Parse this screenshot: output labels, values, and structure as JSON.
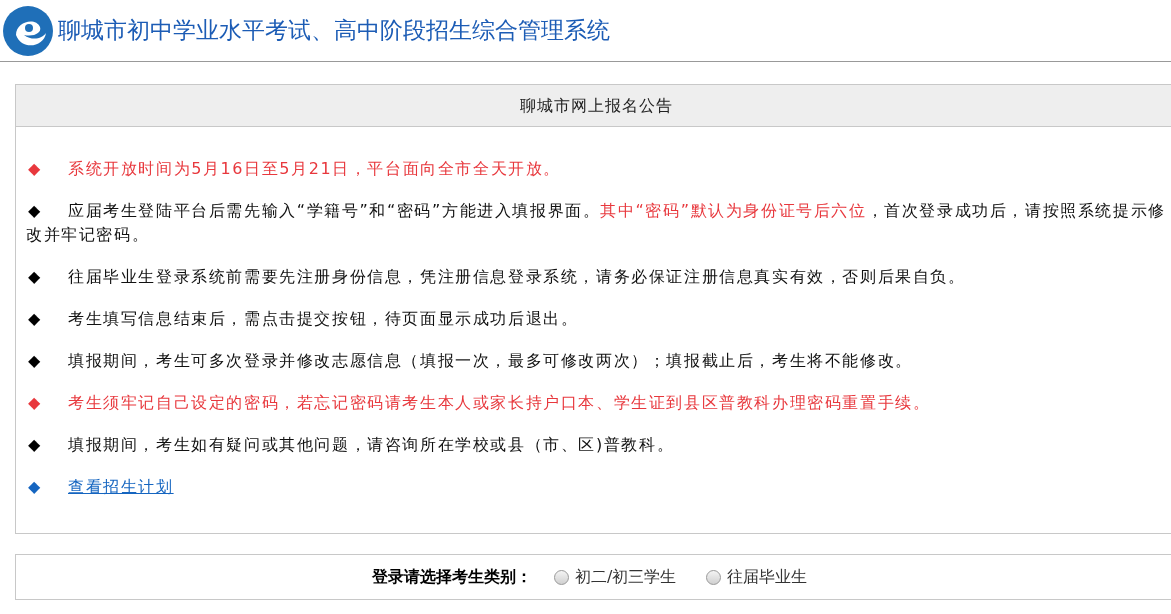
{
  "header": {
    "title": "聊城市初中学业水平考试、高中阶段招生综合管理系统"
  },
  "notice": {
    "title": "聊城市网上报名公告",
    "items": [
      {
        "kind": "text",
        "bullet": "◆",
        "color": "#e8383d",
        "segments": [
          {
            "text": "系统开放时间为5月16日至5月21日，平台面向全市全天开放。",
            "color": "#e8383d"
          }
        ]
      },
      {
        "kind": "text",
        "bullet": "◆",
        "color": "#000000",
        "segments": [
          {
            "text": "应届考生登陆平台后需先输入“学籍号”和“密码”方能进入填报界面。",
            "color": "#111111"
          },
          {
            "text": "其中“密码”默认为身份证号后六位",
            "color": "#e8383d"
          },
          {
            "text": "，首次登录成功后，请按照系统提示修改并牢记密码。",
            "color": "#111111"
          }
        ]
      },
      {
        "kind": "text",
        "bullet": "◆",
        "color": "#000000",
        "segments": [
          {
            "text": "往届毕业生登录系统前需要先注册身份信息，凭注册信息登录系统，请务必保证注册信息真实有效，否则后果自负。",
            "color": "#111111"
          }
        ]
      },
      {
        "kind": "text",
        "bullet": "◆",
        "color": "#000000",
        "segments": [
          {
            "text": "考生填写信息结束后，需点击提交按钮，待页面显示成功后退出。",
            "color": "#111111"
          }
        ]
      },
      {
        "kind": "text",
        "bullet": "◆",
        "color": "#000000",
        "segments": [
          {
            "text": "填报期间，考生可多次登录并修改志愿信息（填报一次，最多可修改两次）；填报截止后，考生将不能修改。",
            "color": "#111111"
          }
        ]
      },
      {
        "kind": "text",
        "bullet": "◆",
        "color": "#e8383d",
        "segments": [
          {
            "text": "考生须牢记自己设定的密码，若忘记密码请考生本人或家长持户口本、学生证到县区普教科办理密码重置手续。",
            "color": "#e8383d"
          }
        ]
      },
      {
        "kind": "text",
        "bullet": "◆",
        "color": "#000000",
        "segments": [
          {
            "text": "填报期间，考生如有疑问或其他问题，请咨询所在学校或县（市、区)普教科。",
            "color": "#111111"
          }
        ]
      },
      {
        "kind": "link",
        "bullet": "◆",
        "color": "#1565c0",
        "label": "查看招生计划"
      }
    ]
  },
  "login": {
    "label": "登录请选择考生类别：",
    "options": [
      {
        "label": "初二/初三学生",
        "selected": false
      },
      {
        "label": "往届毕业生",
        "selected": false
      }
    ]
  }
}
